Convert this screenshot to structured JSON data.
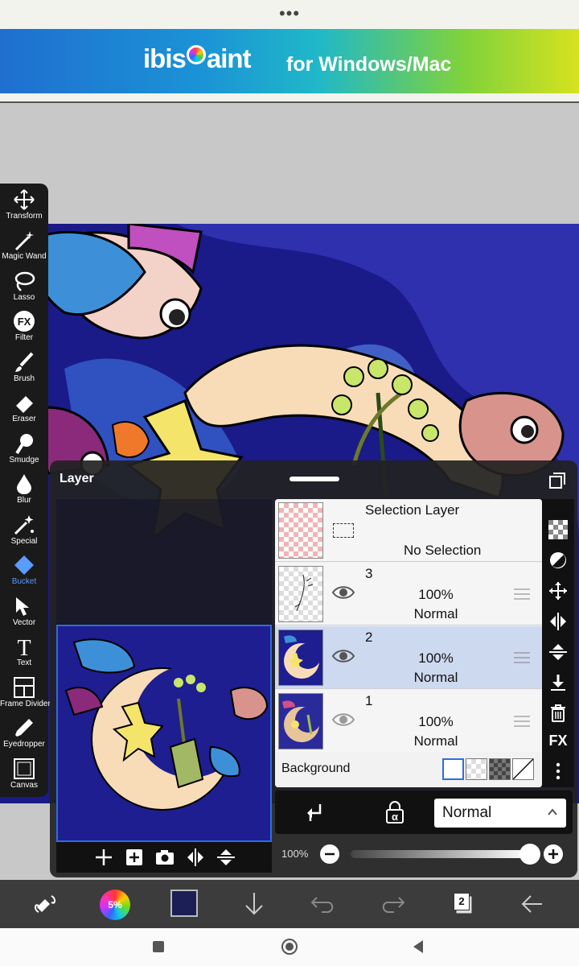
{
  "browser": {
    "menu": "•••"
  },
  "banner": {
    "brand": "ibisPaint",
    "tagline": "for Windows/Mac"
  },
  "toolbar": {
    "items": [
      {
        "label": "Transform",
        "icon": "transform-icon"
      },
      {
        "label": "Magic Wand",
        "icon": "magic-wand-icon"
      },
      {
        "label": "Lasso",
        "icon": "lasso-icon"
      },
      {
        "label": "Filter",
        "icon": "filter-icon"
      },
      {
        "label": "Brush",
        "icon": "brush-icon"
      },
      {
        "label": "Eraser",
        "icon": "eraser-icon"
      },
      {
        "label": "Smudge",
        "icon": "smudge-icon"
      },
      {
        "label": "Blur",
        "icon": "blur-icon"
      },
      {
        "label": "Special",
        "icon": "special-icon"
      },
      {
        "label": "Bucket",
        "icon": "bucket-icon",
        "active": true
      },
      {
        "label": "Vector",
        "icon": "vector-icon"
      },
      {
        "label": "Text",
        "icon": "text-icon"
      },
      {
        "label": "Frame Divider",
        "icon": "frame-divider-icon"
      },
      {
        "label": "Eyedropper",
        "icon": "eyedropper-icon"
      },
      {
        "label": "Canvas",
        "icon": "canvas-icon"
      }
    ],
    "active_color": "#5a9bff"
  },
  "layer_panel": {
    "title": "Layer",
    "selection_layer": {
      "title": "Selection Layer",
      "status": "No Selection"
    },
    "layers": [
      {
        "number": "3",
        "opacity": "100%",
        "mode": "Normal",
        "visible": true,
        "selected": false
      },
      {
        "number": "2",
        "opacity": "100%",
        "mode": "Normal",
        "visible": true,
        "selected": true
      },
      {
        "number": "1",
        "opacity": "100%",
        "mode": "Normal",
        "visible": true,
        "selected": false
      }
    ],
    "background_label": "Background",
    "fx_label": "FX",
    "blend_mode": "Normal",
    "opacity_label": "100%",
    "opacity_value": 1.0,
    "lock_label": "α"
  },
  "bottom_bar": {
    "brush_size": "5%",
    "current_color": "#1b1f55",
    "layer_count": "2"
  }
}
